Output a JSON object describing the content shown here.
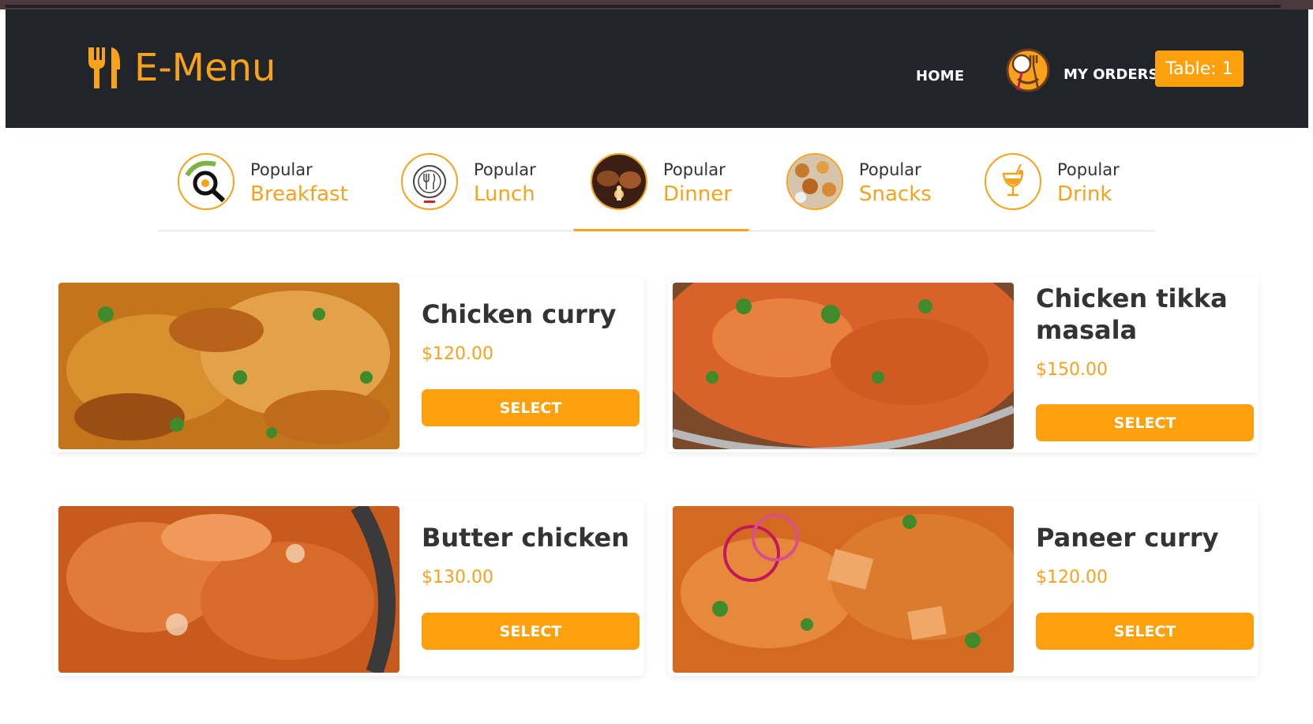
{
  "brand": {
    "name": "E-Menu",
    "icon": "fork-knife-icon"
  },
  "nav": {
    "home": "HOME",
    "orders": "MY ORDERS",
    "table": "Table: 1"
  },
  "categories": [
    {
      "small": "Popular",
      "big": "Breakfast",
      "icon": "breakfast-icon"
    },
    {
      "small": "Popular",
      "big": "Lunch",
      "icon": "lunch-plate-icon"
    },
    {
      "small": "Popular",
      "big": "Dinner",
      "icon": "dinner-photo",
      "active": true
    },
    {
      "small": "Popular",
      "big": "Snacks",
      "icon": "snacks-photo"
    },
    {
      "small": "Popular",
      "big": "Drink",
      "icon": "drink-icon"
    }
  ],
  "items": [
    {
      "name": "Chicken curry",
      "price": "$120.00",
      "button": "SELECT"
    },
    {
      "name": "Chicken tikka masala",
      "price": "$150.00",
      "button": "SELECT"
    },
    {
      "name": "Butter chicken",
      "price": "$130.00",
      "button": "SELECT"
    },
    {
      "name": "Paneer curry",
      "price": "$120.00",
      "button": "SELECT"
    }
  ],
  "colors": {
    "accent": "#fda00e",
    "navbar": "#212529"
  }
}
